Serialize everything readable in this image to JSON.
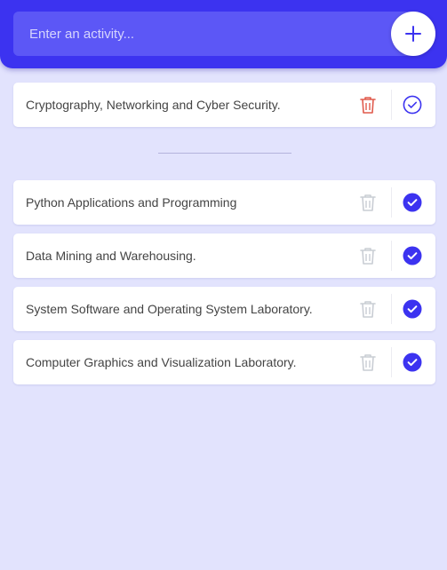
{
  "header": {
    "input_placeholder": "Enter an activity...",
    "add_icon": "plus-icon"
  },
  "colors": {
    "accent": "#3c33f0",
    "background": "#e2e3fd",
    "delete_active": "#e05a4c",
    "delete_inactive": "#c9cdd4"
  },
  "todo": {
    "items": [
      {
        "label": "Cryptography, Networking and Cyber Security.",
        "completed": false
      }
    ]
  },
  "completed": {
    "items": [
      {
        "label": "Python Applications and Programming",
        "completed": true
      },
      {
        "label": "Data Mining and Warehousing.",
        "completed": true
      },
      {
        "label": "System Software and Operating System Laboratory.",
        "completed": true
      },
      {
        "label": "Computer Graphics and Visualization Laboratory.",
        "completed": true
      }
    ]
  }
}
